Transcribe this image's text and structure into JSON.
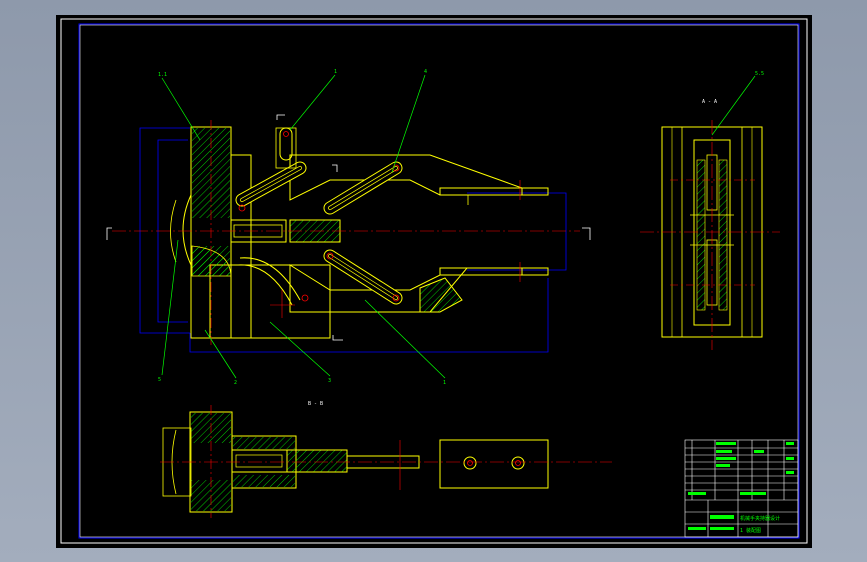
{
  "drawing": {
    "section_aa_label": "A - A",
    "section_bb_label": "B - B",
    "balloons": [
      "1.1",
      "1",
      "4",
      "5",
      "2",
      "3",
      "1",
      "1",
      "5.5"
    ],
    "title_block": {
      "project_title": "机械手夹持器设计",
      "sheet_info": "1   装配图"
    }
  },
  "colors": {
    "frame": "#ffffff",
    "outline": "#ffff00",
    "center": "#ff0000",
    "hatch": "#00ff00",
    "phantom": "#0000ff",
    "text": "#00ff00"
  }
}
